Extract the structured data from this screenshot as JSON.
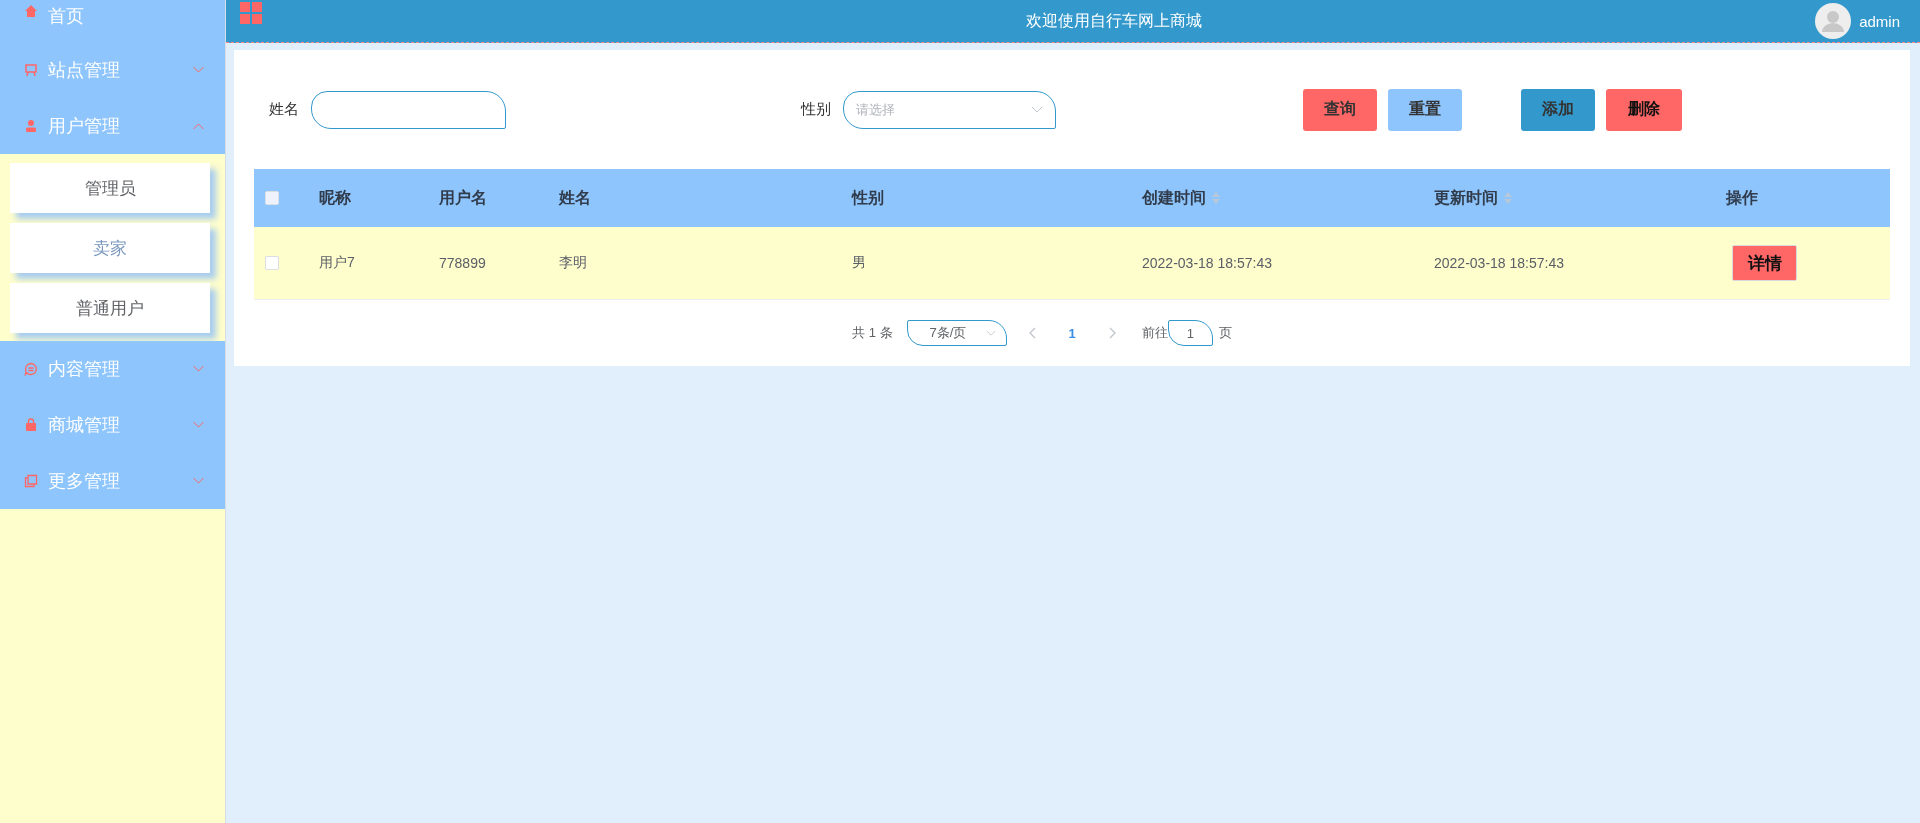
{
  "sidebar": {
    "items": [
      {
        "label": "首页",
        "expandable": false
      },
      {
        "label": "站点管理",
        "expandable": true,
        "expanded": false
      },
      {
        "label": "用户管理",
        "expandable": true,
        "expanded": true,
        "children": [
          {
            "label": "管理员",
            "selected": false
          },
          {
            "label": "卖家",
            "selected": true
          },
          {
            "label": "普通用户",
            "selected": false
          }
        ]
      },
      {
        "label": "内容管理",
        "expandable": true,
        "expanded": false
      },
      {
        "label": "商城管理",
        "expandable": true,
        "expanded": false
      },
      {
        "label": "更多管理",
        "expandable": true,
        "expanded": false
      }
    ]
  },
  "header": {
    "title": "欢迎使用自行车网上商城",
    "user": "admin"
  },
  "search": {
    "fields": [
      {
        "label": "姓名",
        "kind": "input"
      },
      {
        "label": "性别",
        "kind": "select",
        "placeholder": "请选择"
      }
    ],
    "buttons": [
      {
        "label": "查询",
        "color": "#ff6666"
      },
      {
        "label": "重置",
        "color": "#8ec5fc"
      },
      {
        "label": "添加",
        "color": "#3399cc"
      },
      {
        "label": "删除",
        "color": "#ff6666"
      }
    ]
  },
  "table": {
    "select_all": {
      "checked": false
    },
    "columns": [
      {
        "label": "昵称",
        "sortable": false
      },
      {
        "label": "用户名",
        "sortable": false
      },
      {
        "label": "姓名",
        "sortable": false
      },
      {
        "label": "性别",
        "sortable": false
      },
      {
        "label": "创建时间",
        "sortable": true
      },
      {
        "label": "更新时间",
        "sortable": true
      },
      {
        "label": "操作",
        "sortable": false
      }
    ],
    "rows": [
      {
        "checked": false,
        "cells": [
          "用户7",
          "778899",
          "李明",
          "男",
          "2022-03-18 18:57:43",
          "2022-03-18 18:57:43"
        ],
        "action": "详情"
      }
    ]
  },
  "pagination": {
    "total": "共 1 条",
    "page_size": "7条/页",
    "pages": [
      {
        "label": "1",
        "selected": true
      }
    ],
    "goto_label": "前往",
    "goto_value": "1",
    "goto_suffix": "页"
  }
}
